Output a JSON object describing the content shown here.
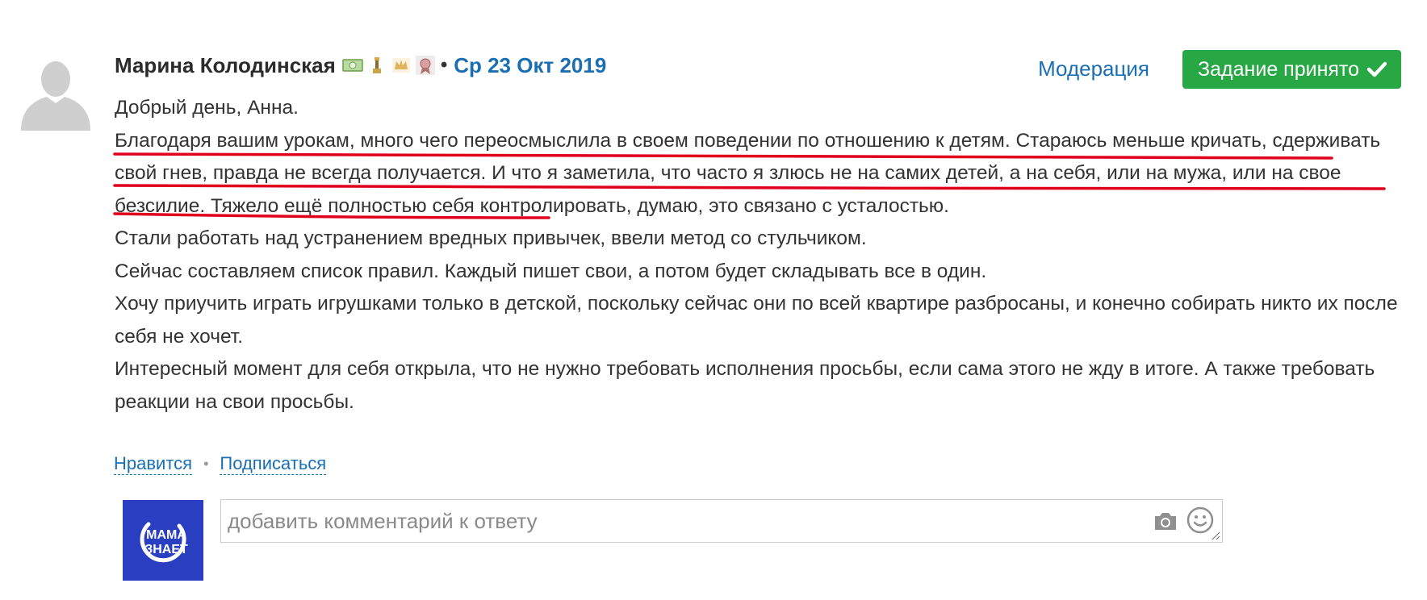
{
  "post": {
    "author": "Марина Колодинская",
    "separator": "•",
    "date": "Ср 23 Окт 2019",
    "badges": [
      "money-badge-icon",
      "trophy-badge-icon",
      "crown-badge-icon",
      "medal-badge-icon"
    ]
  },
  "toolbar": {
    "moderation_label": "Модерация",
    "accepted_label": "Задание принято",
    "accepted_color": "#28a745"
  },
  "body": {
    "greeting": "Добрый день, Анна.",
    "paragraph1": {
      "highlighted": "Благодаря вашим урокам, много чего переосмыслила в своем поведении по отношению к детям. Стараюсь меньше кричать, сдерживать свой гнев, правда не всегда получается. И что я заметила, что часто я злюсь не на самих детей, а на себя, или на мужа, или на свое безсилие.",
      "rest": " Тяжело ещё полностью себя контролировать, думаю, это связано с усталостью."
    },
    "paragraph2": "Стали работать над устранением вредных привычек, ввели метод со стульчиком.",
    "paragraph3": "Сейчас составляем список правил. Каждый пишет свои, а потом будет складывать все в один.",
    "paragraph4": "Хочу приучить играть игрушками только в детской, поскольку сейчас они по всей квартире разбросаны, и конечно собирать никто их после себя не хочет.",
    "paragraph5": "Интересный момент для себя открыла, что не нужно требовать исполнения просьбы, если сама этого не жду в итоге. А также требовать реакции на свои просьбы.",
    "underline_color": "#e0001b"
  },
  "actions": {
    "like_label": "Нравится",
    "dot": "•",
    "subscribe_label": "Подписаться"
  },
  "reply": {
    "placeholder": "добавить комментарий к ответу",
    "avatar_text_top": "МАМА",
    "avatar_text_bottom": "ЗНАЕТ",
    "avatar_color": "#2a3ec1"
  },
  "colors": {
    "link": "#1a6fb3",
    "text": "#333333"
  }
}
